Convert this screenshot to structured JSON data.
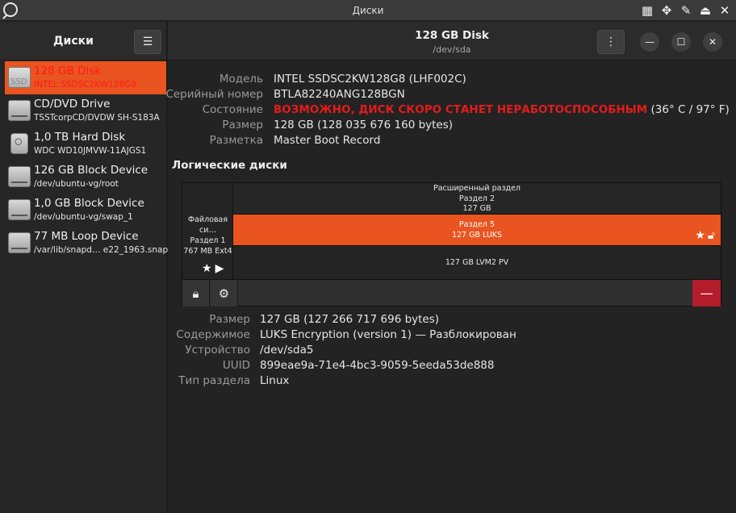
{
  "window": {
    "title": "Диски"
  },
  "sidebar": {
    "title": "Диски",
    "menu_icon": "hamburger-icon",
    "items": [
      {
        "name": "128 GB Disk",
        "sub": "INTEL SSDSC2KW128G8",
        "icon": "ssd-icon",
        "selected": true
      },
      {
        "name": "CD/DVD Drive",
        "sub": "TSSTcorpCD/DVDW SH-S183A",
        "icon": "optical-drive-icon"
      },
      {
        "name": "1,0 TB Hard Disk",
        "sub": "WDC WD10JMVW-11AJGS1",
        "icon": "usb-drive-icon"
      },
      {
        "name": "126 GB Block Device",
        "sub": "/dev/ubuntu-vg/root",
        "icon": "block-device-icon"
      },
      {
        "name": "1,0 GB Block Device",
        "sub": "/dev/ubuntu-vg/swap_1",
        "icon": "block-device-icon"
      },
      {
        "name": "77 MB Loop Device",
        "sub": "/var/lib/snapd… e22_1963.snap",
        "icon": "loop-device-icon"
      }
    ]
  },
  "header": {
    "title": "128 GB Disk",
    "subtitle": "/dev/sda"
  },
  "disk_info": {
    "model_label": "Модель",
    "model": "INTEL SSDSC2KW128G8 (LHF002C)",
    "serial_label": "Серийный номер",
    "serial": "BTLA82240ANG128BGN",
    "status_label": "Состояние",
    "status_warning": "ВОЗМОЖНО, ДИСК СКОРО СТАНЕТ НЕРАБОТОСПОСОБНЫМ",
    "status_temp": " (36° C / 97° F)",
    "size_label": "Размер",
    "size": "128 GB (128 035 676 160 bytes)",
    "partitioning_label": "Разметка",
    "partitioning": "Master Boot Record"
  },
  "volumes": {
    "title": "Логические диски",
    "part1": {
      "line1": "Файловая си…",
      "line2": "Раздел 1",
      "line3": "767 MB Ext4"
    },
    "extended": {
      "line1": "Расширенный раздел",
      "line2": "Раздел 2",
      "line3": "127 GB"
    },
    "luks": {
      "line1": "Раздел 5",
      "line2": "127 GB LUKS"
    },
    "lvm": {
      "line1": "127 GB LVM2 PV"
    }
  },
  "volume_info": {
    "size_label": "Размер",
    "size": "127 GB (127 266 717 696 bytes)",
    "contents_label": "Содержимое",
    "contents": "LUKS Encryption (version 1) — Разблокирован",
    "device_label": "Устройство",
    "device": "/dev/sda5",
    "uuid_label": "UUID",
    "uuid": "899eae9a-71e4-4bc3-9059-5eeda53de888",
    "type_label": "Тип раздела",
    "type": "Linux"
  },
  "colors": {
    "accent": "#e95420",
    "warning": "#e41b1b",
    "delete": "#b51c2b"
  }
}
